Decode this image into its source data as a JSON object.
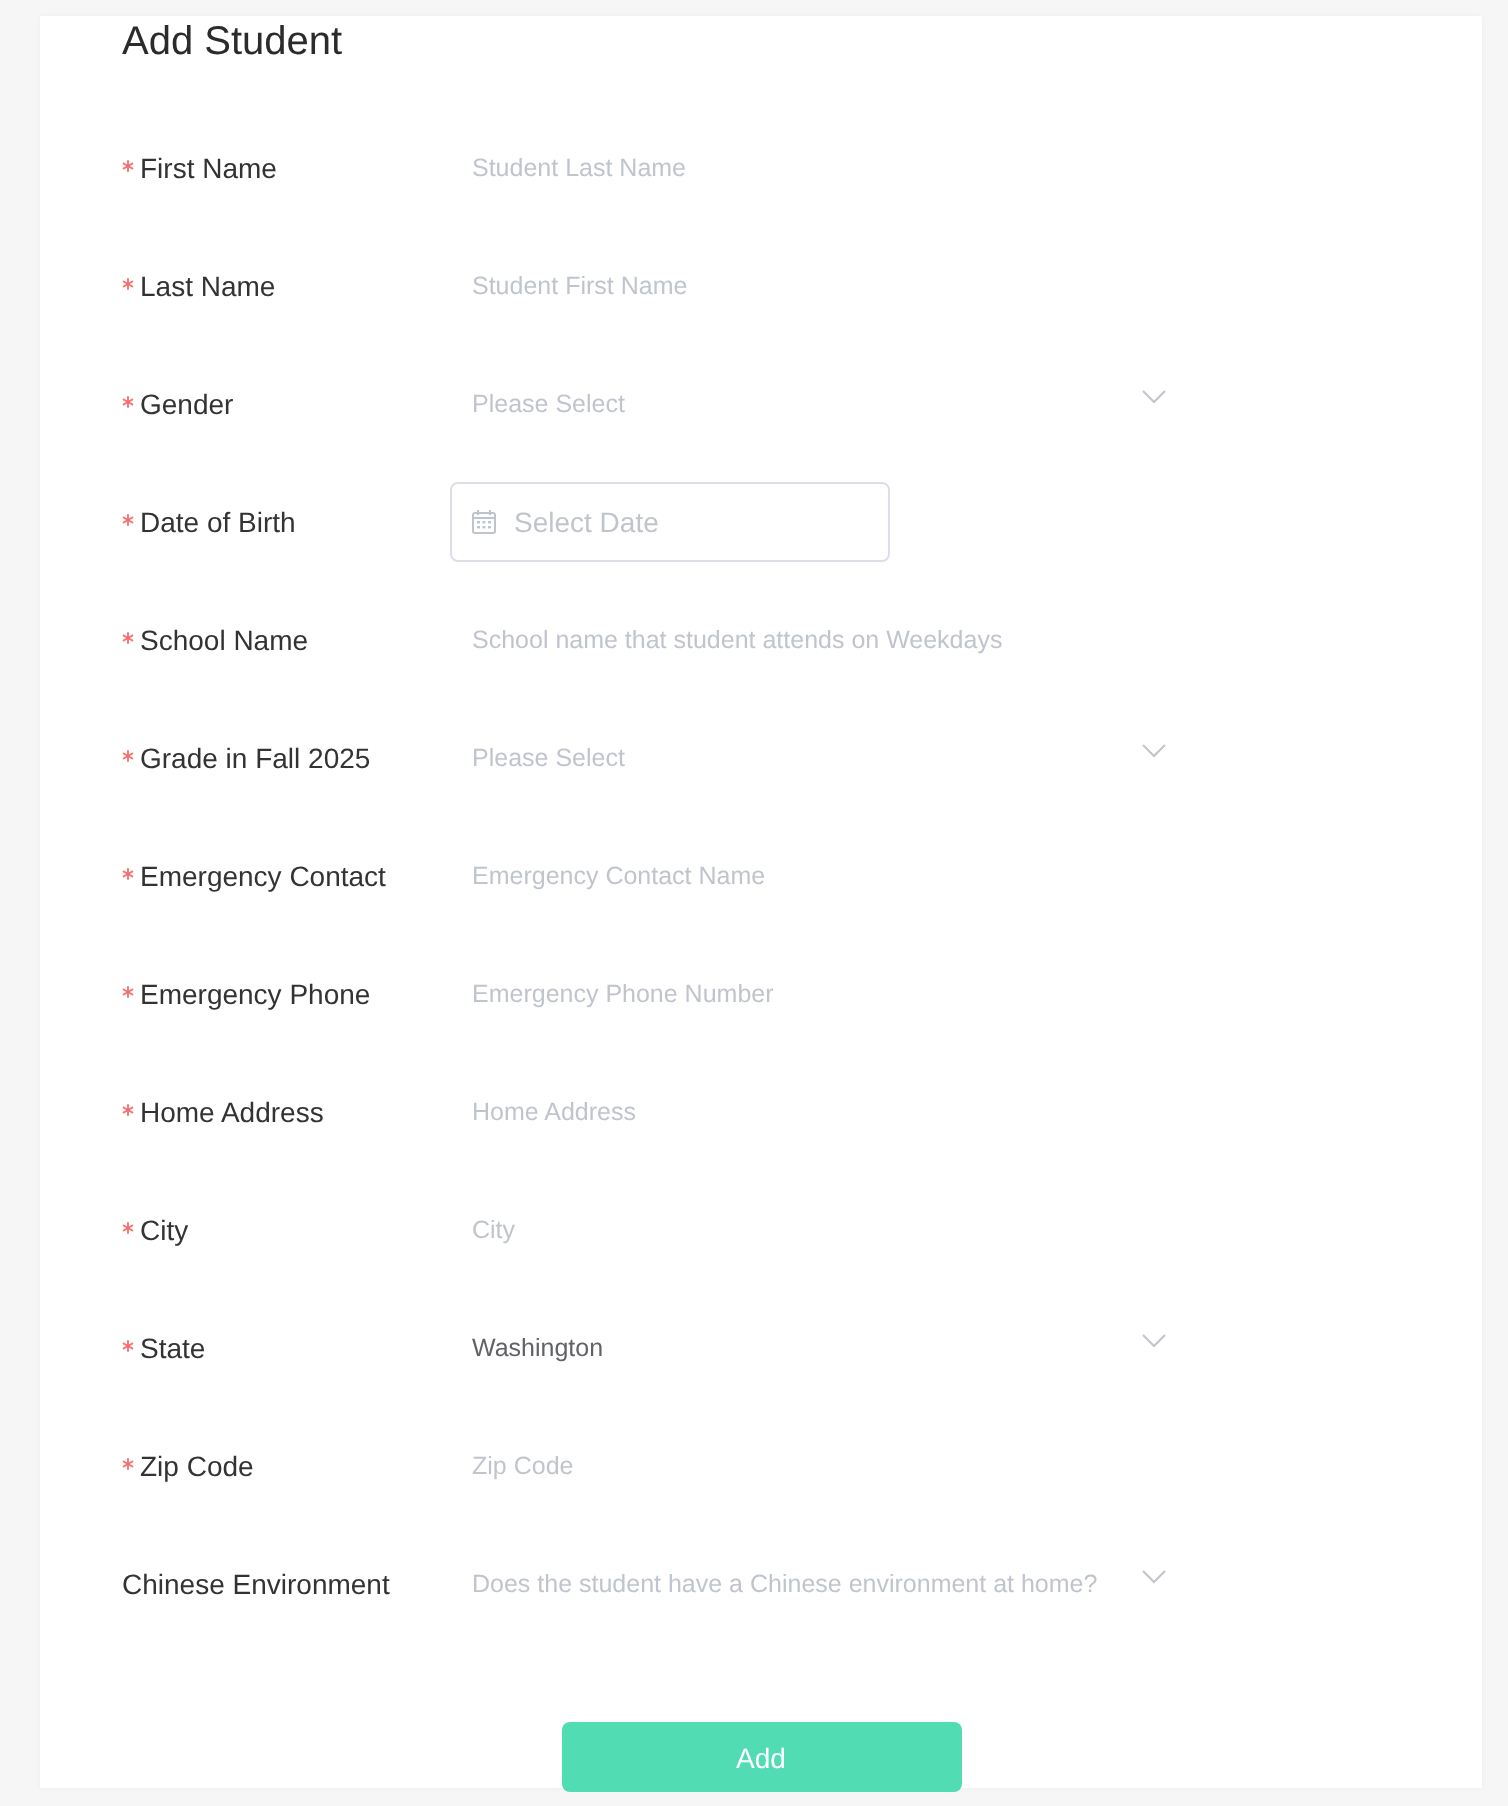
{
  "form": {
    "title": "Add Student",
    "fields": [
      {
        "label": "First Name",
        "required": true,
        "kind": "text",
        "placeholder": "Student Last Name"
      },
      {
        "label": "Last Name",
        "required": true,
        "kind": "text",
        "placeholder": "Student First Name"
      },
      {
        "label": "Gender",
        "required": true,
        "kind": "select",
        "placeholder": "Please Select"
      },
      {
        "label": "Date of Birth",
        "required": true,
        "kind": "date",
        "placeholder": "Select Date"
      },
      {
        "label": "School Name",
        "required": true,
        "kind": "text",
        "placeholder": "School name that student attends on Weekdays"
      },
      {
        "label": "Grade in Fall 2025",
        "required": true,
        "kind": "select",
        "placeholder": "Please Select"
      },
      {
        "label": "Emergency Contact",
        "required": true,
        "kind": "text",
        "placeholder": "Emergency Contact Name"
      },
      {
        "label": "Emergency Phone",
        "required": true,
        "kind": "text",
        "placeholder": "Emergency Phone Number"
      },
      {
        "label": "Home Address",
        "required": true,
        "kind": "text",
        "placeholder": "Home Address"
      },
      {
        "label": "City",
        "required": true,
        "kind": "text",
        "placeholder": "City"
      },
      {
        "label": "State",
        "required": true,
        "kind": "select",
        "value": "Washington"
      },
      {
        "label": "Zip Code",
        "required": true,
        "kind": "text",
        "placeholder": "Zip Code"
      },
      {
        "label": "Chinese Environment",
        "required": false,
        "kind": "select",
        "placeholder": "Does the student have a Chinese environment at home?"
      }
    ],
    "submit": "Add"
  }
}
